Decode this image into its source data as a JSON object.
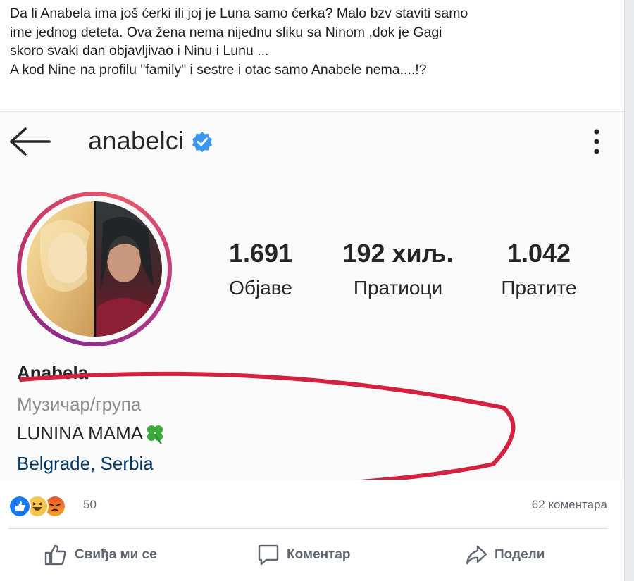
{
  "post": {
    "text_lines": [
      "Da li Anabela ima još ćerki ili joj je Luna samo ćerka? Malo bzv staviti samo",
      "ime jednog deteta. Ova žena nema nijednu sliku sa Ninom ,dok je Gagi",
      "skoro svaki dan objavljivao i Ninu i Lunu ...",
      "A kod Nine na profilu \"family\" i sestre i otac samo Anabele nema....!?"
    ]
  },
  "profile": {
    "username": "anabelci",
    "stats": [
      {
        "value": "1.691",
        "label": "Објаве"
      },
      {
        "value": "192 хиљ.",
        "label": "Пратиоци"
      },
      {
        "value": "1.042",
        "label": "Пратите"
      }
    ],
    "name": "Anabela",
    "category": "Музичар/група",
    "bio": "LUNINA MAMA",
    "location": "Belgrade, Serbia"
  },
  "footer": {
    "reaction_count": "50",
    "comments": "62 коментара",
    "like_label": "Свиђа ми се",
    "comment_label": "Коментар",
    "share_label": "Подели"
  },
  "colors": {
    "ig_blue_verified": "#3897f0",
    "annotation_red": "#d4213f",
    "location_blue": "#00376b",
    "fb_gray": "#606770"
  },
  "icons": [
    "back-arrow-icon",
    "verified-badge-icon",
    "more-options-icon",
    "clover-emoji-icon",
    "like-reaction-icon",
    "haha-reaction-icon",
    "angry-reaction-icon",
    "thumbs-up-icon",
    "comment-icon",
    "share-icon"
  ]
}
